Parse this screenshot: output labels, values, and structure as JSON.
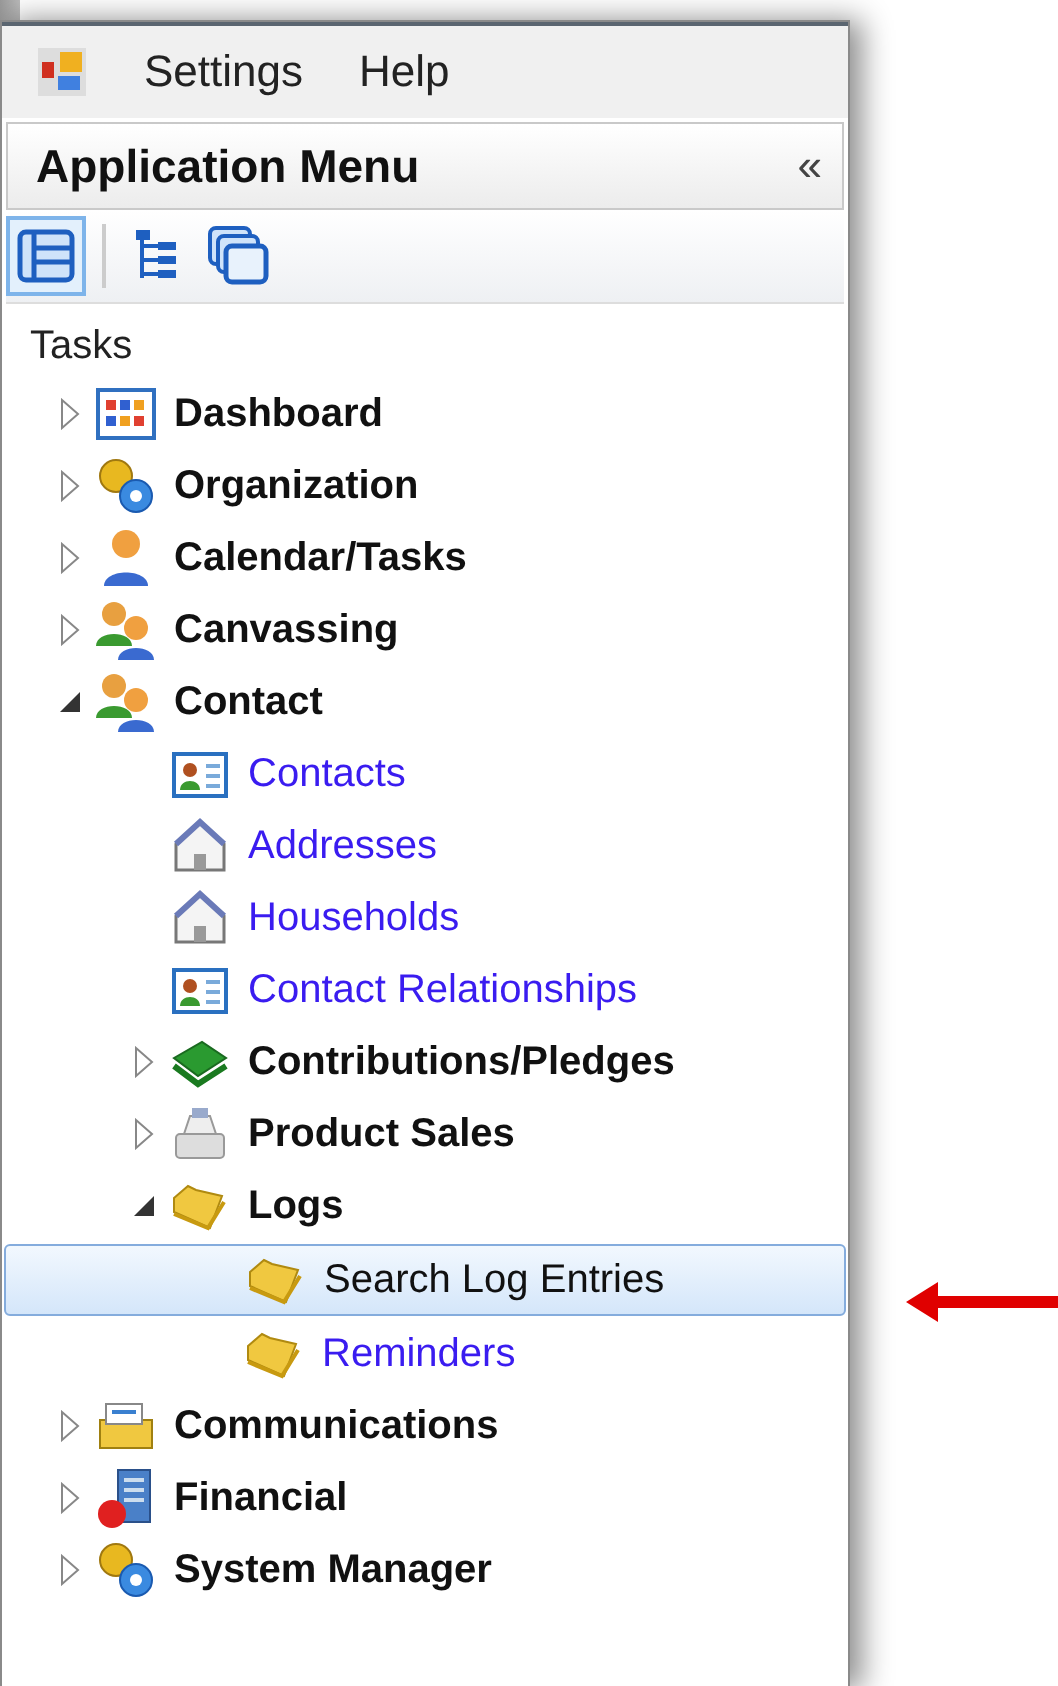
{
  "menu_bar": {
    "items": [
      "Settings",
      "Help"
    ]
  },
  "panel": {
    "title": "Application Menu",
    "collapse": "«"
  },
  "toolbar": [
    {
      "selected": true
    },
    {
      "selected": false
    },
    {
      "selected": false
    }
  ],
  "section": "Tasks",
  "tree": [
    {
      "label": "Dashboard",
      "kind": "group",
      "expanded": false,
      "selected": false
    },
    {
      "label": "Organization",
      "kind": "group",
      "expanded": false,
      "selected": false
    },
    {
      "label": "Calendar/Tasks",
      "kind": "group",
      "expanded": false,
      "selected": false
    },
    {
      "label": "Canvassing",
      "kind": "group",
      "expanded": false,
      "selected": false
    },
    {
      "label": "Contact",
      "kind": "group",
      "expanded": true,
      "selected": false,
      "children": [
        {
          "label": "Contacts",
          "kind": "link",
          "selected": false
        },
        {
          "label": "Addresses",
          "kind": "link",
          "selected": false
        },
        {
          "label": "Households",
          "kind": "link",
          "selected": false
        },
        {
          "label": "Contact Relationships",
          "kind": "link",
          "selected": false
        },
        {
          "label": "Contributions/Pledges",
          "kind": "group",
          "expanded": false,
          "selected": false
        },
        {
          "label": "Product Sales",
          "kind": "group",
          "expanded": false,
          "selected": false
        },
        {
          "label": "Logs",
          "kind": "group",
          "expanded": true,
          "selected": false,
          "children": [
            {
              "label": "Search Log Entries",
              "kind": "link",
              "selected": true
            },
            {
              "label": "Reminders",
              "kind": "link",
              "selected": false
            }
          ]
        }
      ]
    },
    {
      "label": "Communications",
      "kind": "group",
      "expanded": false,
      "selected": false
    },
    {
      "label": "Financial",
      "kind": "group",
      "expanded": false,
      "selected": false
    },
    {
      "label": "System Manager",
      "kind": "group",
      "expanded": false,
      "selected": false
    }
  ]
}
